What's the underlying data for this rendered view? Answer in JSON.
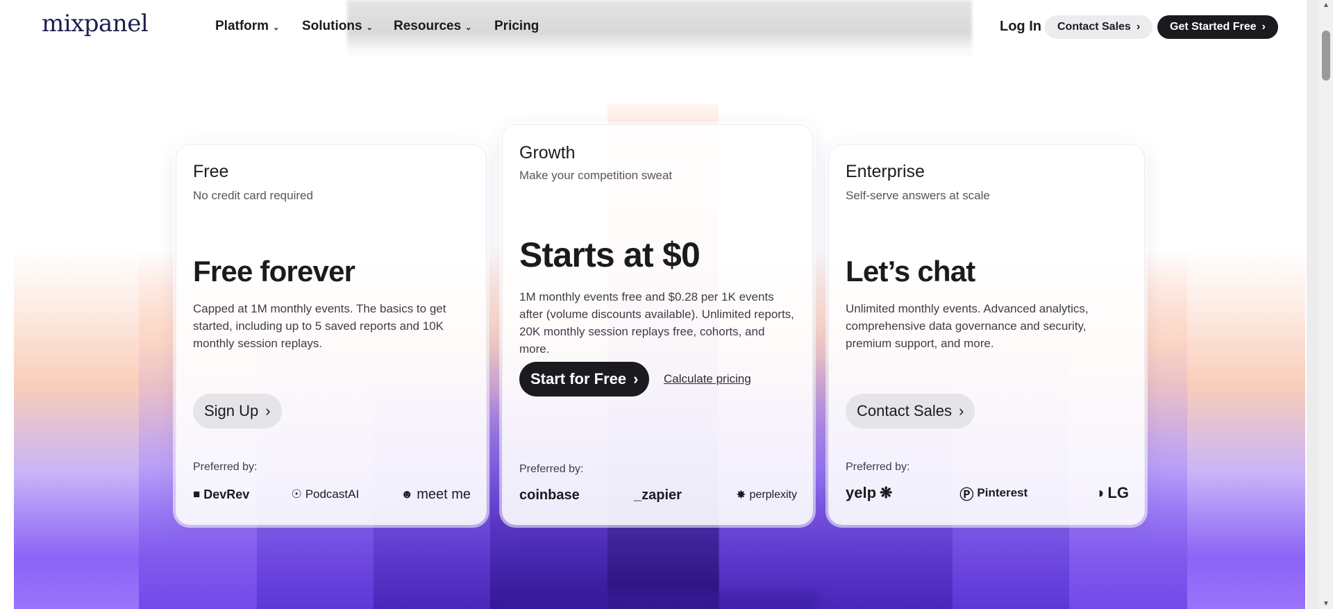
{
  "nav": {
    "logo": "mixpanel",
    "links": [
      {
        "label": "Platform",
        "dropdown": true
      },
      {
        "label": "Solutions",
        "dropdown": true
      },
      {
        "label": "Resources",
        "dropdown": true
      },
      {
        "label": "Pricing",
        "dropdown": false
      }
    ],
    "login": "Log In",
    "contact_sales": "Contact Sales",
    "get_started": "Get Started Free"
  },
  "plans": {
    "free": {
      "name": "Free",
      "subtitle": "No credit card required",
      "price": "Free forever",
      "description": "Capped at 1M monthly events. The basics to get started, including up to 5 saved reports and 10K monthly session replays.",
      "cta": "Sign Up",
      "preferred_label": "Preferred by:",
      "logos": [
        {
          "name": "DevRev",
          "icon": "devrev-icon"
        },
        {
          "name": "PodcastAI",
          "icon": "podcastai-icon"
        },
        {
          "name": "meet me",
          "icon": "meetme-icon"
        }
      ]
    },
    "growth": {
      "name": "Growth",
      "subtitle": "Make your competition sweat",
      "price": "Starts at $0",
      "description": "1M monthly events free and $0.28 per 1K events after (volume discounts available). Unlimited reports, 20K monthly session replays free, cohorts, and more.",
      "cta": "Start for Free",
      "secondary_link": "Calculate pricing",
      "preferred_label": "Preferred by:",
      "logos": [
        {
          "name": "coinbase",
          "icon": ""
        },
        {
          "name": "_zapier",
          "icon": ""
        },
        {
          "name": "perplexity",
          "icon": "perplexity-icon"
        }
      ]
    },
    "enterprise": {
      "name": "Enterprise",
      "subtitle": "Self-serve answers at scale",
      "price": "Let’s chat",
      "description": "Unlimited monthly events. Advanced analytics, comprehensive data governance and security, premium support, and more.",
      "cta": "Contact Sales",
      "preferred_label": "Preferred by:",
      "logos": [
        {
          "name": "yelp",
          "icon": "yelp-burst-icon"
        },
        {
          "name": "Pinterest",
          "icon": "pinterest-icon"
        },
        {
          "name": "LG",
          "icon": "lg-icon"
        }
      ]
    }
  },
  "colors": {
    "dark_button": "#1b1b1f",
    "light_button": "#e4e4e9",
    "purple_glow": "#8b63f6",
    "peach_glow": "#f9cdb9"
  }
}
